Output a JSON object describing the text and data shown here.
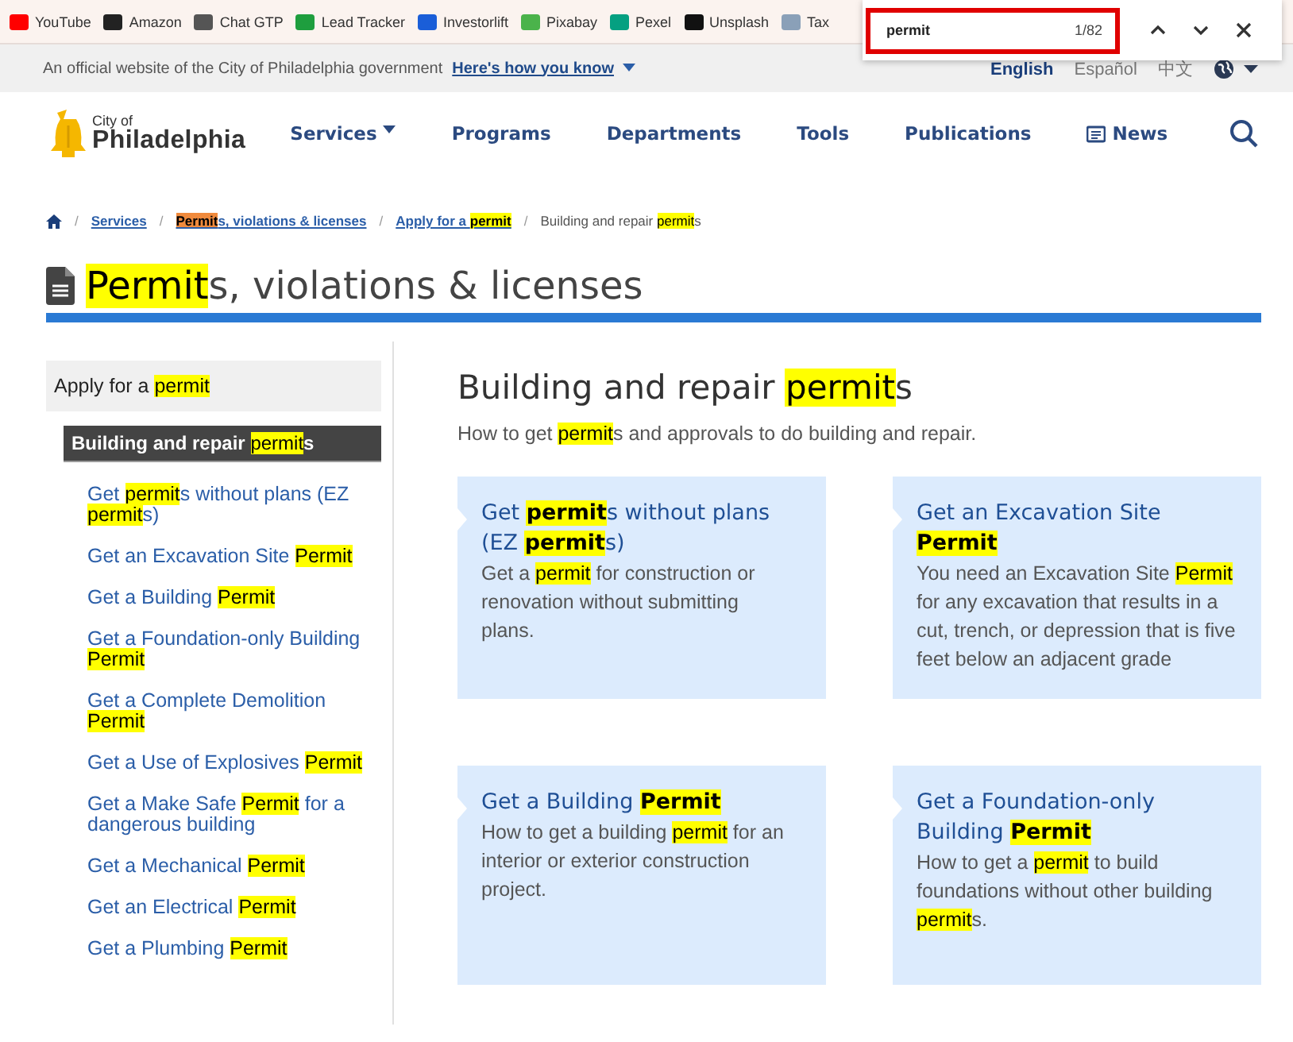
{
  "bookmarks": [
    {
      "label": "YouTube",
      "color": "#ff0000"
    },
    {
      "label": "Amazon",
      "color": "#222222"
    },
    {
      "label": "Chat GTP",
      "color": "#555555"
    },
    {
      "label": "Lead Tracker",
      "color": "#1e9e3e"
    },
    {
      "label": "Investorlift",
      "color": "#1a5ed8"
    },
    {
      "label": "Pixabay",
      "color": "#4bb34b"
    },
    {
      "label": "Pexel",
      "color": "#05a081"
    },
    {
      "label": "Unsplash",
      "color": "#111111"
    },
    {
      "label": "Tax",
      "color": "#8aa0b8"
    }
  ],
  "find_bar": {
    "query": "permit",
    "count": "1/82"
  },
  "gov_banner": {
    "text": "An official website of the City of Philadelphia government",
    "link": "Here's how you know",
    "languages": [
      {
        "label": "English",
        "selected": true
      },
      {
        "label": "Español",
        "selected": false
      },
      {
        "label": "中文",
        "selected": false
      }
    ]
  },
  "header": {
    "logo_small": "City of",
    "logo_large": "Philadelphia",
    "nav": [
      {
        "label": "Services",
        "kind": "dropdown"
      },
      {
        "label": "Programs",
        "kind": "plain"
      },
      {
        "label": "Departments",
        "kind": "plain"
      },
      {
        "label": "Tools",
        "kind": "plain"
      },
      {
        "label": "Publications",
        "kind": "plain"
      },
      {
        "label": "News",
        "kind": "icon"
      }
    ]
  },
  "breadcrumbs": [
    {
      "separator": "/",
      "parts": [
        {
          "text": "Services",
          "kind": "plain"
        }
      ]
    },
    {
      "separator": "/",
      "parts": [
        {
          "text": "Permit",
          "kind": "current-match"
        },
        {
          "text": "s, violations & licenses",
          "kind": "plain"
        }
      ]
    },
    {
      "separator": "/",
      "parts": [
        {
          "text": "Apply for a ",
          "kind": "plain"
        },
        {
          "text": "permit",
          "kind": "match"
        }
      ]
    },
    {
      "separator": "/",
      "parts": [
        {
          "text": "Building and repair ",
          "kind": "plain"
        },
        {
          "text": "permit",
          "kind": "match"
        },
        {
          "text": "s",
          "kind": "plain"
        }
      ]
    }
  ],
  "page_title": [
    {
      "text": "Permit",
      "kind": "match"
    },
    {
      "text": "s, violations & licenses",
      "kind": "plain"
    }
  ],
  "sidebar": {
    "parent": [
      {
        "text": "Apply for a ",
        "kind": "plain"
      },
      {
        "text": "permit",
        "kind": "match"
      }
    ],
    "current": [
      {
        "text": "Building and repair ",
        "kind": "plain"
      },
      {
        "text": "permit",
        "kind": "match"
      },
      {
        "text": "s",
        "kind": "plain"
      }
    ],
    "links": [
      [
        {
          "text": "Get ",
          "kind": "plain"
        },
        {
          "text": "permit",
          "kind": "match"
        },
        {
          "text": "s without plans (EZ ",
          "kind": "plain"
        },
        {
          "text": "permit",
          "kind": "match"
        },
        {
          "text": "s)",
          "kind": "plain"
        }
      ],
      [
        {
          "text": "Get an Excavation Site ",
          "kind": "plain"
        },
        {
          "text": "Permit",
          "kind": "match"
        }
      ],
      [
        {
          "text": "Get a Building ",
          "kind": "plain"
        },
        {
          "text": "Permit",
          "kind": "match"
        }
      ],
      [
        {
          "text": "Get a Foundation-only Building ",
          "kind": "plain"
        },
        {
          "text": "Permit",
          "kind": "match"
        }
      ],
      [
        {
          "text": "Get a Complete Demolition ",
          "kind": "plain"
        },
        {
          "text": "Permit",
          "kind": "match"
        }
      ],
      [
        {
          "text": "Get a Use of Explosives ",
          "kind": "plain"
        },
        {
          "text": "Permit",
          "kind": "match"
        }
      ],
      [
        {
          "text": "Get a Make Safe ",
          "kind": "plain"
        },
        {
          "text": "Permit",
          "kind": "match"
        },
        {
          "text": " for a dangerous building",
          "kind": "plain"
        }
      ],
      [
        {
          "text": "Get a Mechanical ",
          "kind": "plain"
        },
        {
          "text": "Permit",
          "kind": "match"
        }
      ],
      [
        {
          "text": "Get an Electrical ",
          "kind": "plain"
        },
        {
          "text": "Permit",
          "kind": "match"
        }
      ],
      [
        {
          "text": "Get a Plumbing ",
          "kind": "plain"
        },
        {
          "text": "Permit",
          "kind": "match"
        }
      ]
    ]
  },
  "main": {
    "heading": [
      {
        "text": "Building and repair ",
        "kind": "plain"
      },
      {
        "text": "permit",
        "kind": "match"
      },
      {
        "text": "s",
        "kind": "plain"
      }
    ],
    "intro": [
      {
        "text": "How to get ",
        "kind": "plain"
      },
      {
        "text": "permit",
        "kind": "match"
      },
      {
        "text": "s and approvals to do building and repair.",
        "kind": "plain"
      }
    ],
    "cards": [
      {
        "title": [
          {
            "text": "Get ",
            "kind": "plain"
          },
          {
            "text": "permit",
            "kind": "match"
          },
          {
            "text": "s without plans (EZ ",
            "kind": "plain"
          },
          {
            "text": "permit",
            "kind": "match"
          },
          {
            "text": "s)",
            "kind": "plain"
          }
        ],
        "text": [
          {
            "text": "Get a ",
            "kind": "plain"
          },
          {
            "text": "permit",
            "kind": "match"
          },
          {
            "text": " for construction or renovation without submitting plans.",
            "kind": "plain"
          }
        ]
      },
      {
        "title": [
          {
            "text": "Get an Excavation Site ",
            "kind": "plain"
          },
          {
            "text": "Permit",
            "kind": "match"
          }
        ],
        "text": [
          {
            "text": "You need an Excavation Site ",
            "kind": "plain"
          },
          {
            "text": "Permit",
            "kind": "match"
          },
          {
            "text": " for any excavation that results in a cut, trench, or depression that is five feet below an adjacent grade",
            "kind": "plain"
          }
        ]
      },
      {
        "title": [
          {
            "text": "Get a Building ",
            "kind": "plain"
          },
          {
            "text": "Permit",
            "kind": "match"
          }
        ],
        "text": [
          {
            "text": "How to get a building ",
            "kind": "plain"
          },
          {
            "text": "permit",
            "kind": "match"
          },
          {
            "text": " for an interior or exterior construction project.",
            "kind": "plain"
          }
        ]
      },
      {
        "title": [
          {
            "text": "Get a Foundation-only Building ",
            "kind": "plain"
          },
          {
            "text": "Permit",
            "kind": "match"
          }
        ],
        "text": [
          {
            "text": "How to get a ",
            "kind": "plain"
          },
          {
            "text": "permit",
            "kind": "match"
          },
          {
            "text": " to build foundations without other building ",
            "kind": "plain"
          },
          {
            "text": "permit",
            "kind": "match"
          },
          {
            "text": "s.",
            "kind": "plain"
          }
        ]
      }
    ]
  }
}
